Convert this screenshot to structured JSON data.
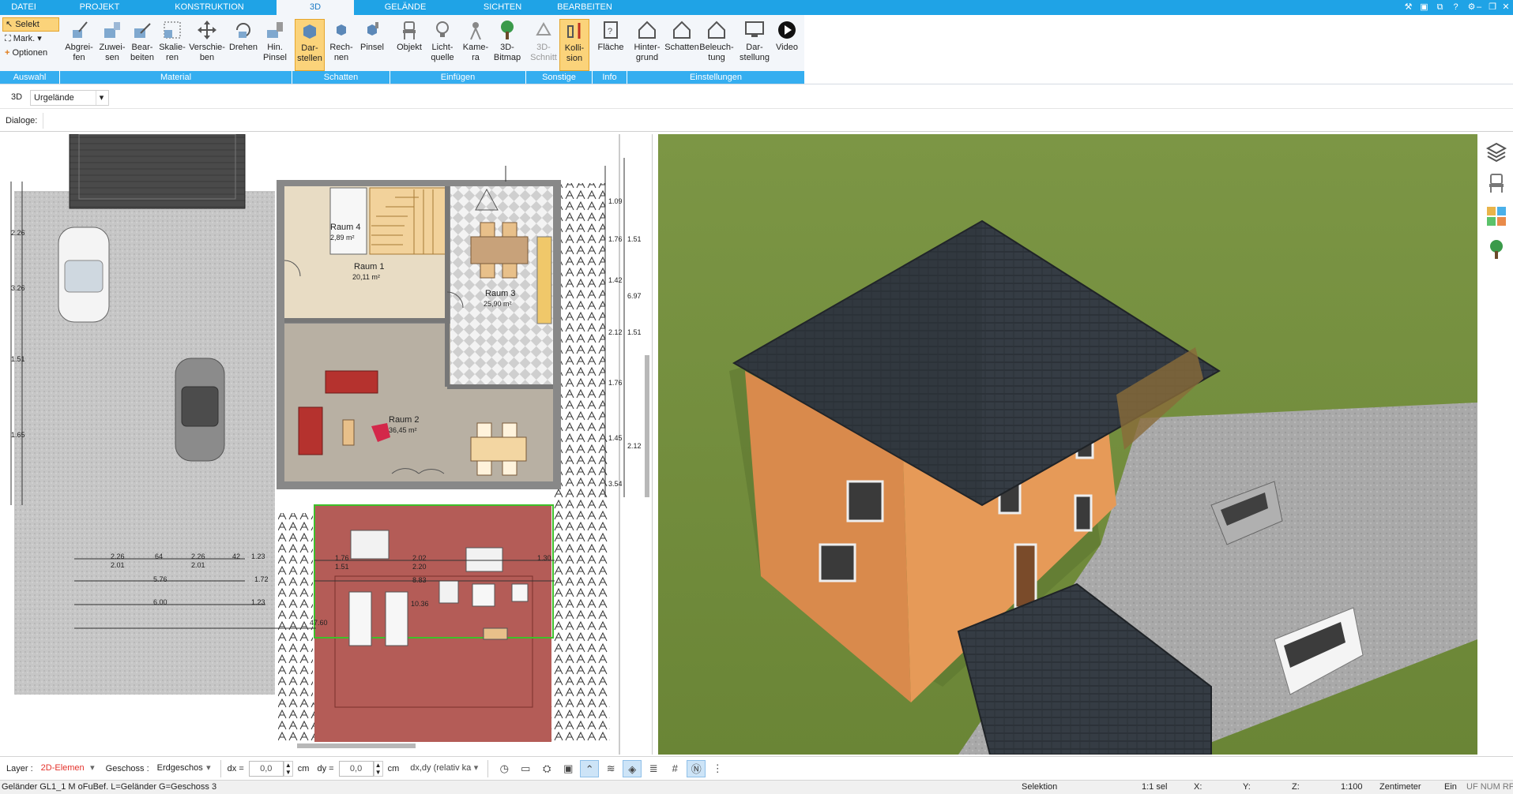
{
  "tabs": [
    "DATEI",
    "PROJEKT",
    "KONSTRUKTION",
    "3D",
    "GELÄNDE",
    "SICHTEN",
    "BEARBEITEN"
  ],
  "active_tab": "3D",
  "ribbon": {
    "selection": {
      "select": "Selekt",
      "mark": "Mark.",
      "options": "Optionen"
    },
    "buttons": {
      "abgreifen": "Abgrei-\nfen",
      "zuweisen": "Zuwei-\nsen",
      "bearbeiten": "Bear-\nbeiten",
      "skalieren": "Skalie-\nren",
      "verschieben": "Verschie-\nben",
      "drehen": "Drehen",
      "hinpinsel": "Hin.\nPinsel",
      "darstellen": "Dar-\nstellen",
      "rechnen": "Rech-\nnen",
      "pinsel": "Pinsel",
      "objekt": "Objekt",
      "lichtquelle": "Licht-\nquelle",
      "kamera": "Kame-\nra",
      "bitmap3d": "3D-\nBitmap",
      "schnitt3d": "3D-\nSchnitt",
      "kollision": "Kolli-\nsion",
      "flaeche": "Fläche",
      "hintergrund": "Hinter-\ngrund",
      "schatten": "Schatten",
      "beleuchtung": "Beleuch-\ntung",
      "darstellung": "Dar-\nstellung",
      "video": "Video"
    },
    "groups": [
      "Auswahl",
      "Material",
      "Schatten",
      "Einfügen",
      "Sonstige",
      "Info",
      "Einstellungen"
    ]
  },
  "toolbar2": {
    "mode": "3D",
    "terrain": "Urgelände"
  },
  "toolbar3": {
    "label": "Dialoge:"
  },
  "plan": {
    "rooms": [
      {
        "name": "Raum 4",
        "area": "2,89 m²"
      },
      {
        "name": "Raum 1",
        "area": "20,11 m²"
      },
      {
        "name": "Raum 3",
        "area": "25,90 m²"
      },
      {
        "name": "Raum 2",
        "area": "36,45 m²"
      }
    ],
    "dims": [
      "2.26",
      "2.01",
      "64",
      "2.26",
      "2.01",
      "42",
      "1.23",
      "5.76",
      "1.72",
      "6.00",
      "1.23",
      "1.76",
      "1.51",
      "2.02",
      "2.20",
      "1.30",
      "8.83",
      "10.36",
      "47.60",
      "1.76",
      "1.51",
      "1.09",
      "1.76",
      "1.51",
      "6.97",
      "1.42",
      "2.12",
      "1.76",
      "1.51",
      "1.45",
      "3.54",
      "2.12",
      "2.26",
      "3.26",
      "1.51",
      "1.65"
    ]
  },
  "bottom": {
    "layer_label": "Layer :",
    "layer_value": "2D-Elemen",
    "geschoss_label": "Geschoss :",
    "geschoss_value": "Erdgeschos",
    "dx_label": "dx =",
    "dx_value": "0,0",
    "dx_unit": "cm",
    "dy_label": "dy =",
    "dy_value": "0,0",
    "dy_unit": "cm",
    "mode_value": "dx,dy (relativ ka"
  },
  "status": {
    "left": "Geländer GL1_1 M oFuBef. L=Geländer G=Geschoss 3",
    "selektion": "Selektion",
    "count": "1:1 sel",
    "x": "X:",
    "y": "Y:",
    "z": "Z:",
    "scale": "1:100",
    "unit": "Zentimeter",
    "ein": "Ein",
    "flags": "UF NUM RF"
  },
  "colors": {
    "tab_blue": "#1fa3e6",
    "group_blue": "#35aef0",
    "active_orange": "#fbd37a",
    "red_layer": "#e4322b"
  }
}
